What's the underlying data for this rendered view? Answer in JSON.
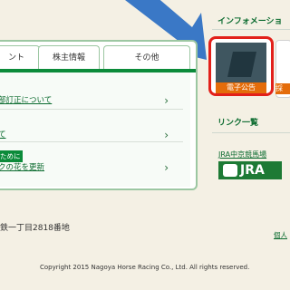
{
  "tabs": [
    {
      "label": "ント"
    },
    {
      "label": "株主情報"
    },
    {
      "label": "その他"
    }
  ],
  "news": [
    {
      "text": "部訂正について",
      "is_link": true
    },
    {
      "text": "て",
      "is_link": true
    },
    {
      "badge": "ために",
      "text": "クの花を更新",
      "is_link": true
    }
  ],
  "footer": {
    "address": "鉄一丁目2818番地",
    "copyright": "Copyright 2015 Nagoya Horse Racing Co., Ltd. All rights reserved.",
    "privacy_link": "個人"
  },
  "sidebar": {
    "info_title": "インフォメーショ",
    "info_card_label": "電子公告",
    "partial_card_label": "採",
    "links_title": "リンク一覧",
    "jra_link": "JRA中京競馬場",
    "jra_logo_text": "JRA"
  },
  "annotation": {
    "arrow_color": "#3a78c6"
  }
}
